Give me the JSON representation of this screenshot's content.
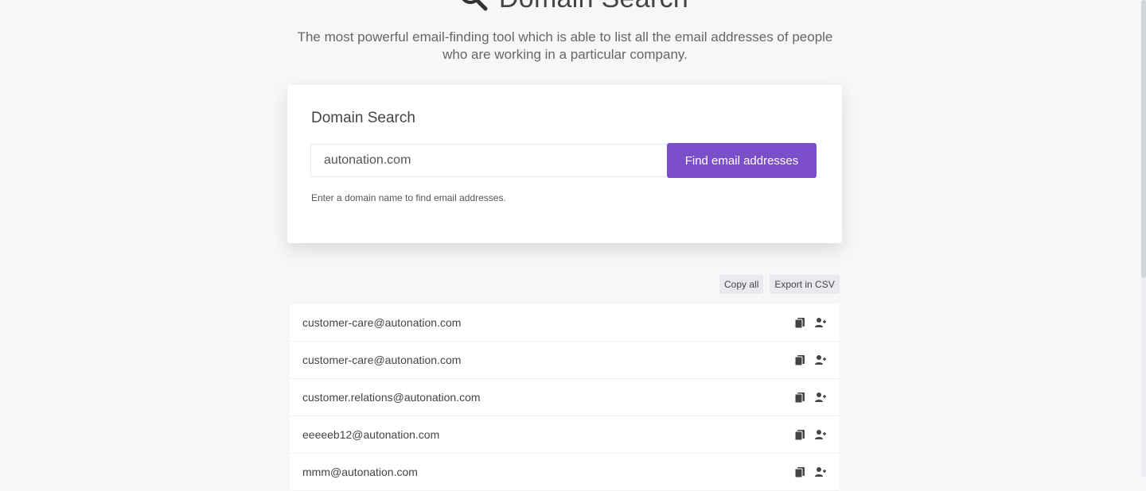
{
  "header": {
    "title": "Domain Search",
    "subtitle": "The most powerful email-finding tool which is able to list all the email addresses of people who are working in a particular company."
  },
  "search_card": {
    "title": "Domain Search",
    "input_value": "autonation.com",
    "button_label": "Find email addresses",
    "helper_text": "Enter a domain name to find email addresses."
  },
  "actions": {
    "copy_all_label": "Copy all",
    "export_csv_label": "Export in CSV"
  },
  "results": [
    {
      "email": "customer-care@autonation.com"
    },
    {
      "email": "customer-care@autonation.com"
    },
    {
      "email": "customer.relations@autonation.com"
    },
    {
      "email": "eeeeeb12@autonation.com"
    },
    {
      "email": "mmm@autonation.com"
    }
  ],
  "icons": {
    "search": "search-icon",
    "copy": "copy-icon",
    "add_contact": "add-contact-icon"
  },
  "colors": {
    "accent": "#7b4fc9",
    "background": "#f6f7f9"
  }
}
